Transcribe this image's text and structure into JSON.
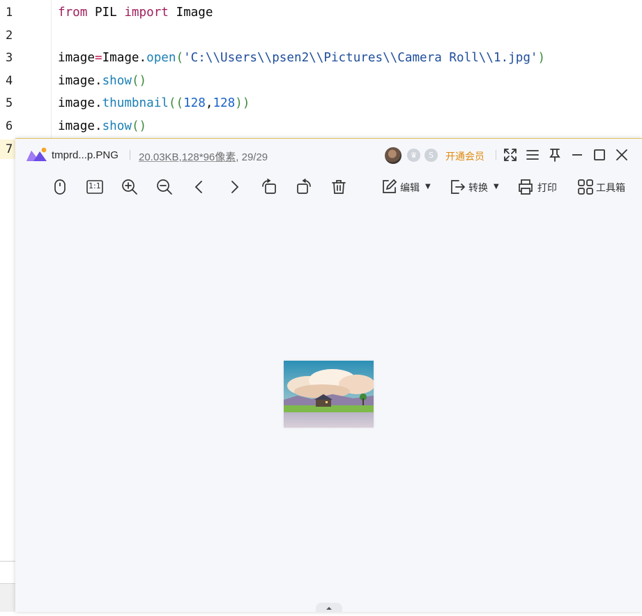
{
  "editor": {
    "line_numbers": [
      "1",
      "2",
      "3",
      "4",
      "5",
      "6",
      "7"
    ],
    "lines": {
      "l1": {
        "kw1": "from",
        "t1": " PIL ",
        "kw2": "import",
        "t2": " Image"
      },
      "l3": {
        "var": "image",
        "eq": "=",
        "cls": "Image",
        "dot": ".",
        "fn": "open",
        "p1": "(",
        "str": "'C:\\\\Users\\\\psen2\\\\Pictures\\\\Camera Roll\\\\1.jpg'",
        "p2": ")"
      },
      "l4": {
        "var": "image",
        "dot": ".",
        "fn": "show",
        "p": "()"
      },
      "l5": {
        "var": "image",
        "dot": ".",
        "fn": "thumbnail",
        "p1": "((",
        "n1": "128",
        "comma": ",",
        "n2": "128",
        "p2": "))"
      },
      "l6": {
        "var": "image",
        "dot": ".",
        "fn": "show",
        "p": "()"
      }
    }
  },
  "viewer": {
    "file_name": "tmprd...p.PNG",
    "file_size": "20.03KB",
    "dimensions": ",128*96像素",
    "position": ", 29/29",
    "vip_label": "开通会员",
    "toolbar": {
      "edit_label": "编辑",
      "convert_label": "转换",
      "print_label": "打印",
      "toolbox_label": "工具箱",
      "actual_size_label": "1:1"
    },
    "colors": {
      "accent": "#e08a0e",
      "background": "#f6f7fb"
    }
  }
}
